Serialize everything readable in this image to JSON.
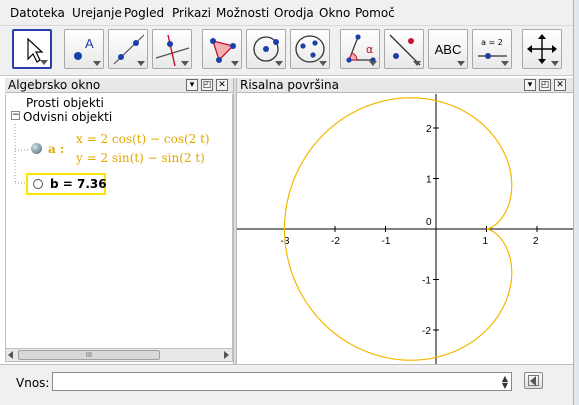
{
  "menu": [
    "Datoteka",
    "Urejanje",
    "Pogled",
    "Prikazi",
    "Možnosti",
    "Orodja",
    "Okno",
    "Pomoč"
  ],
  "toolbar": {
    "tools": [
      {
        "name": "move-tool",
        "icon": "cursor-arrow",
        "active": true
      },
      {
        "name": "point-tool",
        "icon": "point-A",
        "label": "A"
      },
      {
        "name": "line-tool",
        "icon": "line-through-two-points"
      },
      {
        "name": "perpendicular-tool",
        "icon": "perpendicular-line"
      },
      {
        "name": "polygon-tool",
        "icon": "polygon"
      },
      {
        "name": "circle-tool",
        "icon": "circle-center-point"
      },
      {
        "name": "conic-tool",
        "icon": "ellipse"
      },
      {
        "name": "angle-tool",
        "icon": "angle",
        "label": "α"
      },
      {
        "name": "reflect-tool",
        "icon": "reflect-about-line"
      },
      {
        "name": "text-tool",
        "icon": "text",
        "label": "ABC"
      },
      {
        "name": "slider-tool",
        "icon": "slider",
        "label": "a = 2"
      },
      {
        "name": "move-graphics-tool",
        "icon": "move-arrows"
      }
    ]
  },
  "algebra": {
    "title": "Algebrsko okno",
    "free_objects": "Prosti objekti",
    "dependent_objects": "Odvisni objekti",
    "curve_label": "a :",
    "curve_eq1": "x = 2 cos(t) − cos(2 t)",
    "curve_eq2": "y = 2 sin(t) − sin(2 t)",
    "slider_text": "b = 7.36",
    "scroll_grip": "III"
  },
  "graphics": {
    "title": "Risalna površina",
    "x_ticks": [
      "-3",
      "-2",
      "-1",
      "0",
      "1",
      "2"
    ],
    "y_ticks": [
      "2",
      "1",
      "-1",
      "-2"
    ],
    "curve_color": "#f2b800",
    "axis_color": "#000000"
  },
  "inputbar": {
    "label": "Vnos:",
    "value": ""
  },
  "colors": {
    "highlight": "#ffe600",
    "accent": "#2a3fb0",
    "curve": "#e8b400"
  }
}
